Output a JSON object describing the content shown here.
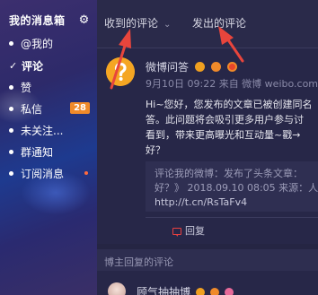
{
  "sidebar": {
    "title": "我的消息箱",
    "items": [
      {
        "label": "@我的"
      },
      {
        "label": "评论"
      },
      {
        "label": "赞"
      },
      {
        "label": "私信",
        "badge": "28"
      },
      {
        "label": "未关注..."
      },
      {
        "label": "群通知"
      },
      {
        "label": "订阅消息"
      }
    ]
  },
  "tabs": {
    "received": "收到的评论",
    "sent": "发出的评论"
  },
  "message": {
    "sender": "微博问答",
    "meta": "9月10日 09:22 来自 微博 weibo.com",
    "body": [
      "Hi~您好，您发布的文章已被创建同名",
      "答。此问题将会吸引更多用户参与讨",
      "看到，带来更高曝光和互动量~戳→",
      "好？"
    ],
    "quote": [
      "评论我的微博：发布了头条文章：",
      "好？》 2018.09.10 08:05 来源：人",
      "http://t.cn/RsTaFv4"
    ],
    "reply_label": "回复"
  },
  "section": {
    "label": "博主回复的评论"
  },
  "next": {
    "name": "顾气抽抽博"
  },
  "colors": {
    "accent_orange": "#f5a623",
    "badge": "#f08a2a",
    "arrow": "#e8453c",
    "reply_icon": "#e84040"
  }
}
